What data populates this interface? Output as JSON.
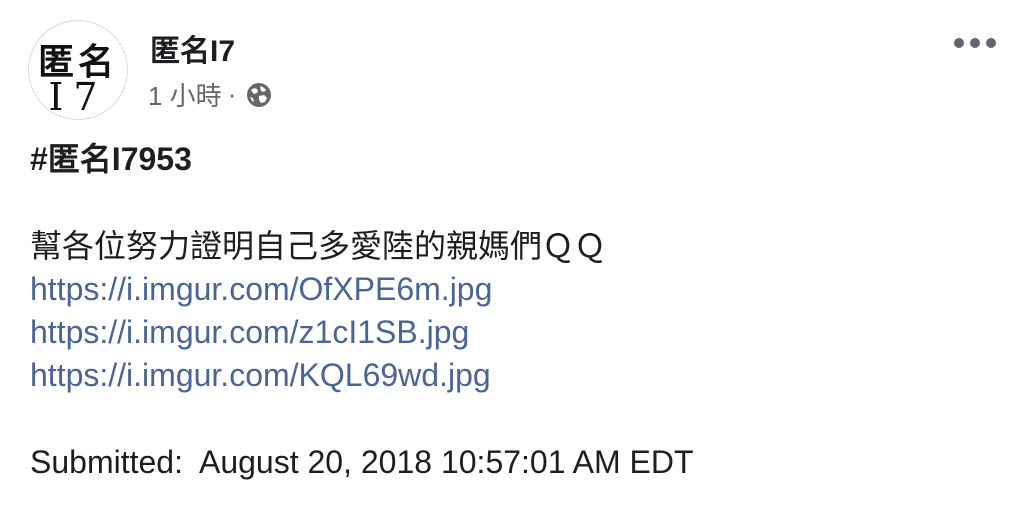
{
  "post": {
    "avatar": {
      "line1": "匿名",
      "line2": "I7"
    },
    "page_name": "匿名I7",
    "time_ago": "1 小時",
    "separator": "·",
    "hashtag": "#匿名I7953",
    "message": "幫各位努力證明自己多愛陸的親媽們ＱＱ",
    "links": [
      "https://i.imgur.com/OfXPE6m.jpg",
      "https://i.imgur.com/z1cI1SB.jpg",
      "https://i.imgur.com/KQL69wd.jpg"
    ],
    "submitted": "Submitted:  August 20, 2018 10:57:01 AM EDT"
  },
  "icons": {
    "privacy": "globe-icon",
    "menu": "more-options-icon"
  },
  "colors": {
    "link": "#4a6593",
    "meta_text": "#65676b",
    "text": "#1c1e21"
  }
}
